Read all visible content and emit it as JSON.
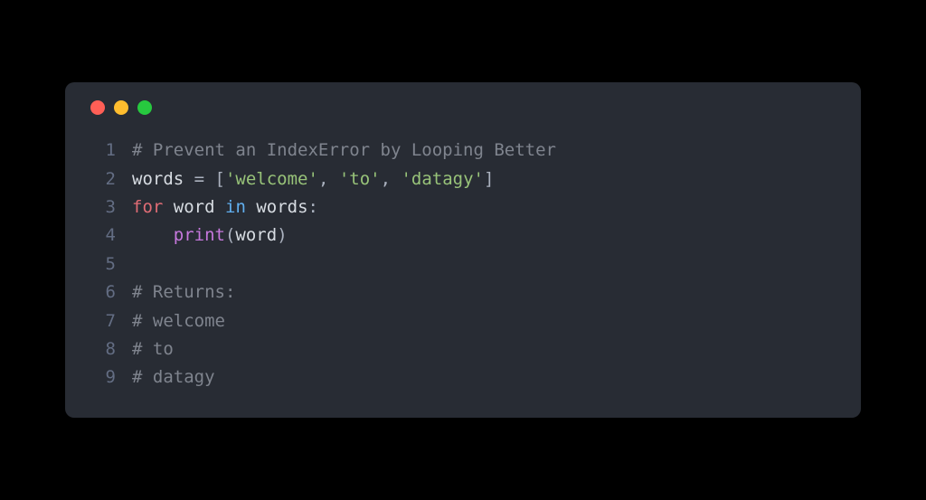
{
  "colors": {
    "background": "#000000",
    "window": "#282c34",
    "traffic_red": "#ff5f56",
    "traffic_yellow": "#ffbd2e",
    "traffic_green": "#27c93f",
    "lineno": "#636d83",
    "comment": "#7f848e",
    "variable": "#e5c07b",
    "default_text": "#d7dce2",
    "string": "#98c379",
    "keyword_for": "#e06c75",
    "keyword_in": "#61afef",
    "function": "#c678dd"
  },
  "code": {
    "line1": {
      "num": "1",
      "comment": "# Prevent an IndexError by Looping Better"
    },
    "line2": {
      "num": "2",
      "var": "words",
      "eq": " = ",
      "lb": "[",
      "s1": "'welcome'",
      "c1": ", ",
      "s2": "'to'",
      "c2": ", ",
      "s3": "'datagy'",
      "rb": "]"
    },
    "line3": {
      "num": "3",
      "kw_for": "for",
      "sp1": " ",
      "iter": "word",
      "sp2": " ",
      "kw_in": "in",
      "sp3": " ",
      "coll": "words",
      "colon": ":"
    },
    "line4": {
      "num": "4",
      "indent": "    ",
      "fn": "print",
      "lp": "(",
      "arg": "word",
      "rp": ")"
    },
    "line5": {
      "num": "5"
    },
    "line6": {
      "num": "6",
      "comment": "# Returns:"
    },
    "line7": {
      "num": "7",
      "comment": "# welcome"
    },
    "line8": {
      "num": "8",
      "comment": "# to"
    },
    "line9": {
      "num": "9",
      "comment": "# datagy"
    }
  }
}
